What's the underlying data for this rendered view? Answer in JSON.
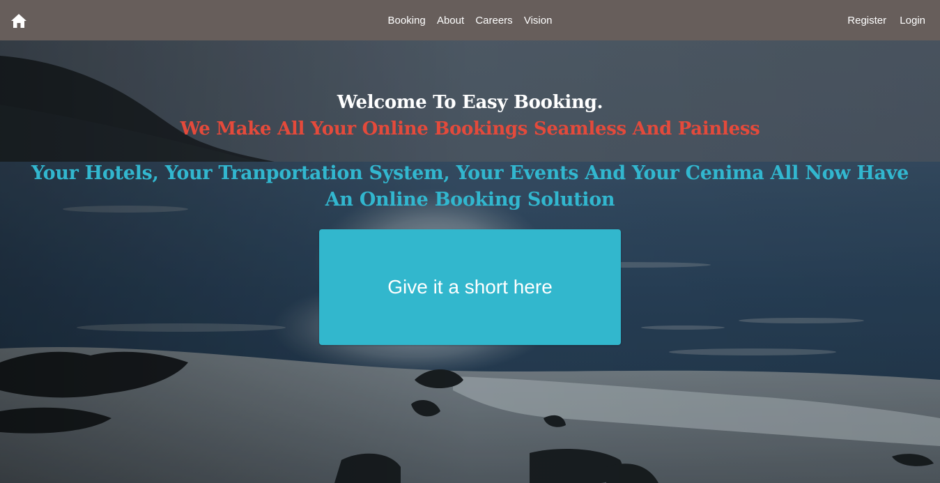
{
  "navbar": {
    "home_icon": "home-icon",
    "links": [
      "Booking",
      "About",
      "Careers",
      "Vision"
    ],
    "auth": {
      "register": "Register",
      "login": "Login"
    }
  },
  "hero": {
    "welcome": "Welcome To Easy Booking.",
    "tagline": "We Make All Your Online Bookings Seamless And Painless",
    "description": "Your Hotels, Your Tranportation System, Your Events And Your Cenima All Now Have An Online Booking Solution",
    "cta_label": "Give it a short here"
  },
  "colors": {
    "navbar_bg": "#675e5b",
    "tagline": "#e44a3b",
    "description": "#32b7cf",
    "cta_bg": "#32b7cd"
  }
}
